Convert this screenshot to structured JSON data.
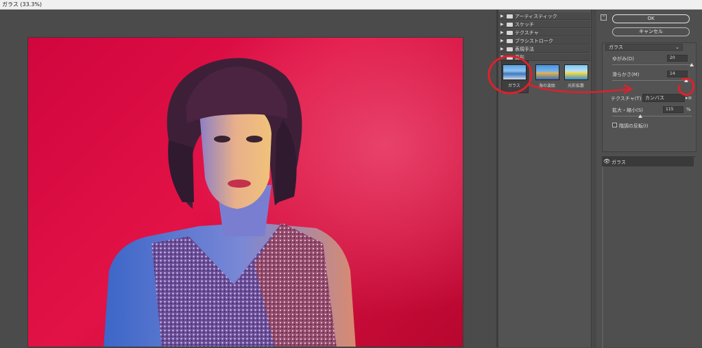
{
  "window": {
    "title": "ガラス (33.3%)"
  },
  "gallery": {
    "categories": [
      {
        "label": "アーティスティック",
        "expanded": false
      },
      {
        "label": "スケッチ",
        "expanded": false
      },
      {
        "label": "テクスチャ",
        "expanded": false
      },
      {
        "label": "ブラシストローク",
        "expanded": false
      },
      {
        "label": "表現手法",
        "expanded": false
      },
      {
        "label": "変形",
        "expanded": true
      }
    ],
    "filters": [
      {
        "label": "ガラス",
        "selected": true
      },
      {
        "label": "海の波紋",
        "selected": false
      },
      {
        "label": "光彩拡散",
        "selected": false
      }
    ]
  },
  "buttons": {
    "ok": "OK",
    "cancel": "キャンセル"
  },
  "settings": {
    "filter_name": "ガラス",
    "distortion_label": "ゆがみ(D)",
    "distortion_value": "20",
    "smoothness_label": "滑らかさ(M)",
    "smoothness_value": "14",
    "texture_label": "テクスチャ(T)",
    "texture_value": "カンバス",
    "scaling_label": "拡大・縮小(S)",
    "scaling_value": "115",
    "scaling_unit": "%",
    "invert_label": "階調の反転(I)",
    "invert_checked": false,
    "distortion_level": 1.0,
    "smoothness_level": 0.93,
    "scaling_level": 0.35
  },
  "layers": {
    "items": [
      {
        "name": "ガラス",
        "visible": true
      }
    ]
  },
  "colors": {
    "annotation": "#e0202c",
    "background_red": "#d0063e"
  }
}
